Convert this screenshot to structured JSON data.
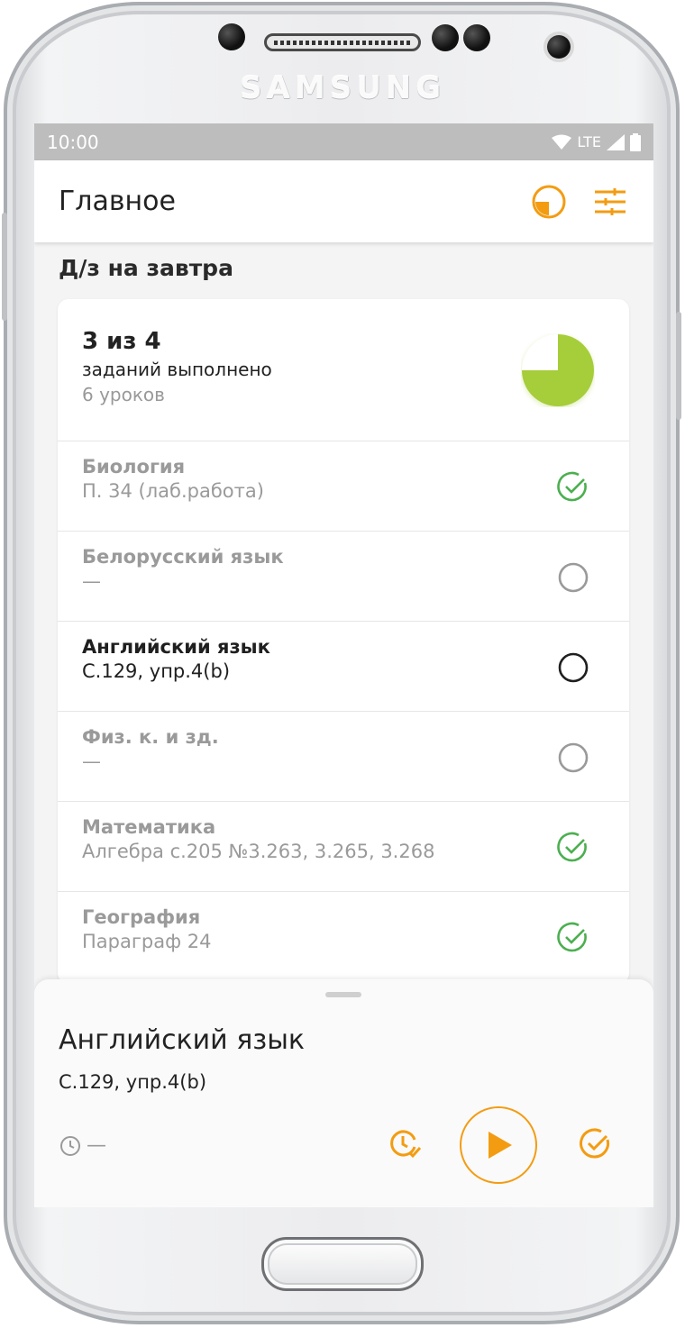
{
  "device": {
    "brand": "SAMSUNG"
  },
  "status_bar": {
    "time": "10:00",
    "network": "LTE"
  },
  "app_bar": {
    "title": "Главное"
  },
  "section": {
    "title": "Д/з на завтра"
  },
  "summary": {
    "count": "3 из 4",
    "done_label": "заданий выполнено",
    "lessons": "6 уроков",
    "progress": 0.75,
    "progress_color": "#a6cd3a"
  },
  "rows": [
    {
      "subject": "Биология",
      "task": "П. 34 (лаб.работа)",
      "state": "done"
    },
    {
      "subject": "Белорусский язык",
      "task": "—",
      "state": "empty"
    },
    {
      "subject": "Английский язык",
      "task": "С.129, упр.4(b)",
      "state": "active"
    },
    {
      "subject": "Физ. к. и зд.",
      "task": "—",
      "state": "empty"
    },
    {
      "subject": "Математика",
      "task": "Алгебра с.205 №3.263, 3.265, 3.268",
      "state": "done"
    },
    {
      "subject": "География",
      "task": "Параграф 24",
      "state": "done"
    }
  ],
  "sheet": {
    "title": "Английский язык",
    "task": "С.129, упр.4(b)",
    "time": "—"
  },
  "colors": {
    "accent": "#f39c12",
    "done": "#4caf50",
    "muted": "#9a9a9a"
  },
  "icons": {
    "appbar": [
      "progress-icon",
      "filter-settings-icon"
    ],
    "sheet": [
      "clock-icon",
      "snooze-clock-icon",
      "play-icon",
      "check-icon"
    ]
  }
}
